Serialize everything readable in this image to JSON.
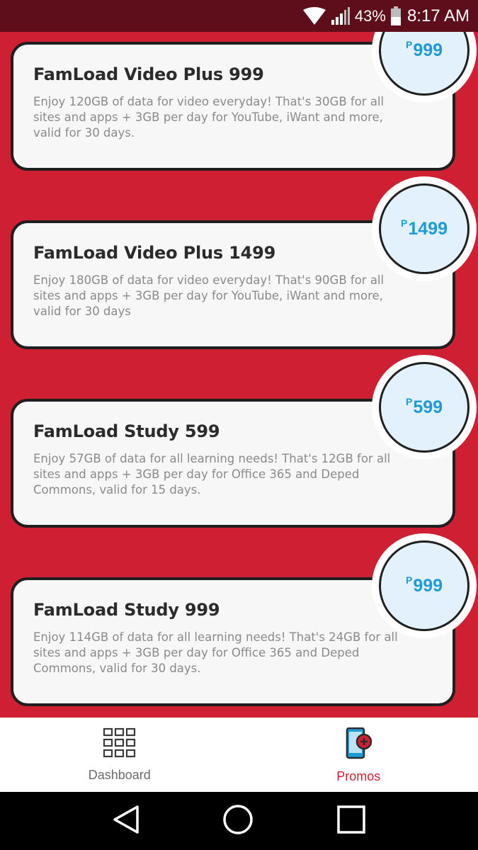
{
  "status_bar": {
    "battery_percent": "43%",
    "time": "8:17 AM",
    "icons": [
      "wifi-icon",
      "signal-icon",
      "battery-icon"
    ]
  },
  "colors": {
    "background": "#cf1f33",
    "status_bar": "#5e0e1a",
    "price_text": "#1e9bd7",
    "price_bg": "#e2f1fb",
    "active_nav": "#cf1f33"
  },
  "promos": [
    {
      "title": "FamLoad Video Plus 999",
      "description": "Enjoy 120GB of data for video everyday! That's 30GB for all sites and apps + 3GB per day for YouTube, iWant and more, valid for 30 days.",
      "currency": "P",
      "price": "999"
    },
    {
      "title": "FamLoad Video Plus 1499",
      "description": "Enjoy 180GB of data for video everyday! That's 90GB for all sites and apps + 3GB per day for YouTube, iWant and more, valid for 30 days",
      "currency": "P",
      "price": "1499"
    },
    {
      "title": "FamLoad Study 599",
      "description": "Enjoy 57GB of data for all learning needs! That's 12GB for all sites and apps + 3GB per day for Office 365 and Deped Commons, valid for 15 days.",
      "currency": "P",
      "price": "599"
    },
    {
      "title": "FamLoad Study 999",
      "description": "Enjoy 114GB of data for all learning needs! That's 24GB for all sites and apps + 3GB per day for Office 365 and Deped Commons, valid for 30 days.",
      "currency": "P",
      "price": "999"
    }
  ],
  "bottom_nav": {
    "items": [
      {
        "label": "Dashboard",
        "icon": "dashboard-grid-icon",
        "active": false
      },
      {
        "label": "Promos",
        "icon": "promos-phone-icon",
        "active": true
      }
    ]
  },
  "system_nav": {
    "icons": [
      "back-icon",
      "home-icon",
      "recents-icon"
    ]
  }
}
